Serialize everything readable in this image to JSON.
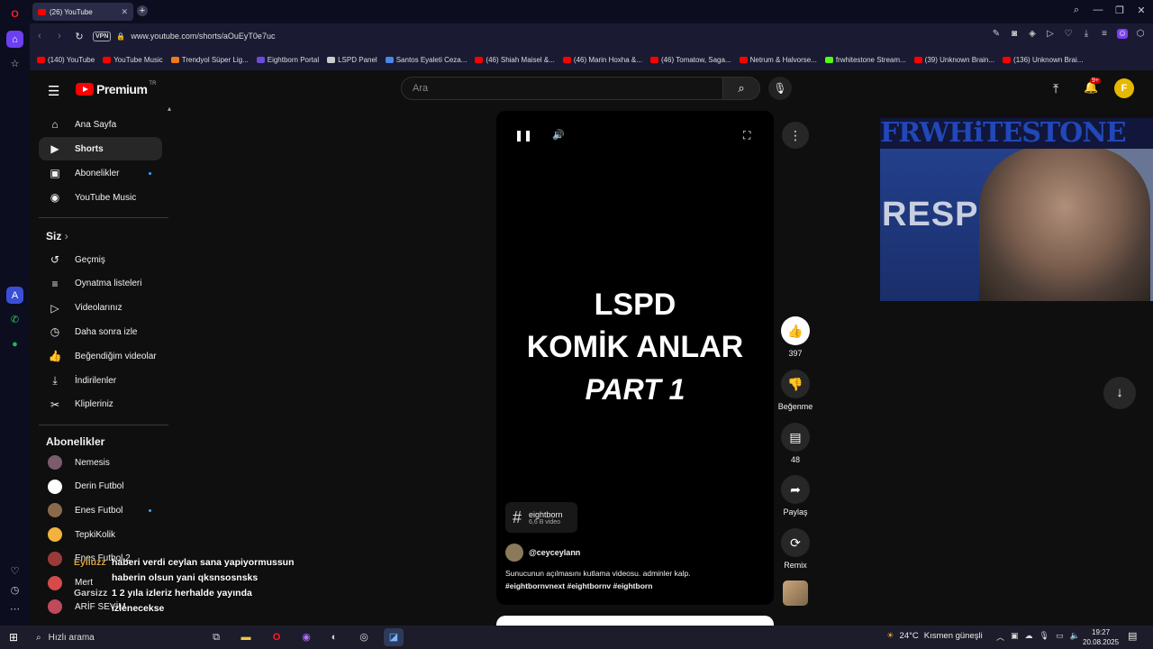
{
  "browser": {
    "tab_title": "(26) YouTube",
    "url": "www.youtube.com/shorts/aOuEyT0e7uc",
    "vpn_label": "VPN",
    "bookmarks": [
      {
        "label": "(140) YouTube",
        "color": "#ff0000"
      },
      {
        "label": "YouTube Music",
        "color": "#ff0000"
      },
      {
        "label": "Trendyol Süper Lig...",
        "color": "#f27a1a"
      },
      {
        "label": "Eightborn Portal",
        "color": "#6b4cd6"
      },
      {
        "label": "LSPD Panel",
        "color": "#cccccc"
      },
      {
        "label": "Santos Eyaleti Ceza...",
        "color": "#4a86e8"
      },
      {
        "label": "(46) Shiah Maisel &...",
        "color": "#ff0000"
      },
      {
        "label": "(46) Marin Hoxha &...",
        "color": "#ff0000"
      },
      {
        "label": "(46) Tomatow, Saga...",
        "color": "#ff0000"
      },
      {
        "label": "Netrum & Halvorse...",
        "color": "#ff0000"
      },
      {
        "label": "frwhitestone Stream...",
        "color": "#53fc18"
      },
      {
        "label": "(39) Unknown Brain...",
        "color": "#ff0000"
      },
      {
        "label": "(136) Unknown Brai...",
        "color": "#ff0000"
      }
    ]
  },
  "youtube": {
    "logo_text": "Premium",
    "logo_region": "TR",
    "search_placeholder": "Ara",
    "notification_badge": "9+",
    "nav_main": [
      {
        "label": "Ana Sayfa",
        "icon": "home-icon",
        "glyph": "⌂"
      },
      {
        "label": "Shorts",
        "icon": "shorts-icon",
        "glyph": "▶"
      },
      {
        "label": "Abonelikler",
        "icon": "subscriptions-icon",
        "glyph": "▣"
      },
      {
        "label": "YouTube Music",
        "icon": "music-icon",
        "glyph": "◉"
      }
    ],
    "you_section": "Siz",
    "nav_you": [
      {
        "label": "Geçmiş",
        "icon": "history-icon",
        "glyph": "↺"
      },
      {
        "label": "Oynatma listeleri",
        "icon": "playlist-icon",
        "glyph": "≡"
      },
      {
        "label": "Videolarınız",
        "icon": "your-videos-icon",
        "glyph": "▷"
      },
      {
        "label": "Daha sonra izle",
        "icon": "watch-later-icon",
        "glyph": "◷"
      },
      {
        "label": "Beğendiğim videolar",
        "icon": "liked-icon",
        "glyph": "👍"
      },
      {
        "label": "İndirilenler",
        "icon": "download-icon",
        "glyph": "⤓"
      },
      {
        "label": "Klipleriniz",
        "icon": "clips-icon",
        "glyph": "✂"
      }
    ],
    "subs_section": "Abonelikler",
    "subscriptions": [
      {
        "label": "Nemesis",
        "color": "#7a5c6e"
      },
      {
        "label": "Derin Futbol",
        "color": "#ffffff"
      },
      {
        "label": "Enes Futbol",
        "color": "#8a6a4a"
      },
      {
        "label": "TepkiKolik",
        "color": "#f2b33d"
      },
      {
        "label": "Enes Futbol 2",
        "color": "#9c3a3a"
      },
      {
        "label": "Mert",
        "color": "#d64a4a"
      },
      {
        "label": "ARİF SEVİM",
        "color": "#c04a5a"
      }
    ],
    "short": {
      "title_line1": "LSPD",
      "title_line2": "KOMİK ANLAR",
      "title_line3": "PART 1",
      "hashtag_name": "eightborn",
      "hashtag_count": "6,6 B video",
      "channel": "@ceyceylann",
      "description": "Sunucunun açılmasını kutlama videosu. adminler kalp.",
      "description_tags": "#eightbornvnext #eightbornv #eightborn",
      "likes": "397",
      "dislike_label": "Beğenme",
      "comments": "48",
      "share_label": "Paylaş",
      "remix_label": "Remix"
    },
    "webcam_banner": "FRWHiTESTONE",
    "webcam_flag_text": "RESPECT"
  },
  "chat": [
    {
      "user": "Eylluzz",
      "lines": [
        "haberi verdi ceylan sana yapiyormussun",
        "haberin olsun yani qksnsosnsks"
      ]
    },
    {
      "user": "Garsizz",
      "lines": [
        "1 2 yıla izleriz herhalde yayında",
        "izlenecekse"
      ]
    }
  ],
  "taskbar": {
    "search_label": "Hızlı arama",
    "weather_temp": "24°C",
    "weather_text": "Kısmen güneşli",
    "time": "19:27",
    "date": "20.08.2025"
  }
}
